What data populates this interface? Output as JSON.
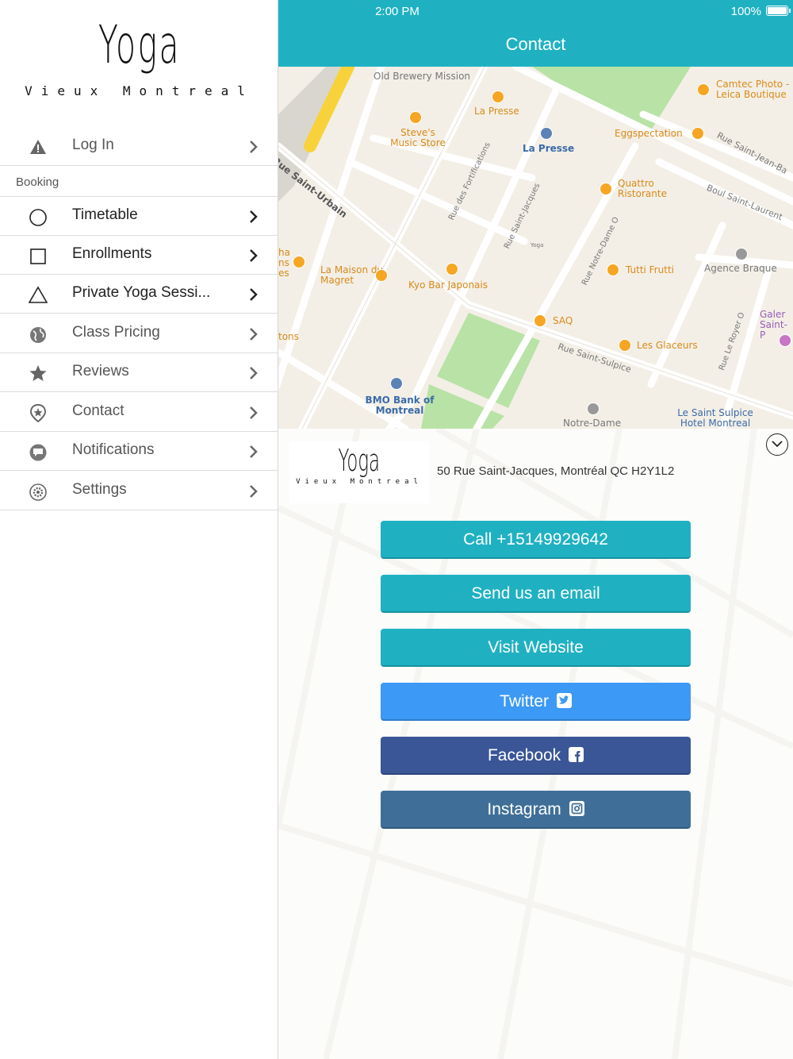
{
  "status": {
    "time": "2:00 PM",
    "battery": "100%"
  },
  "sidebar": {
    "logo": {
      "word": "Yoga",
      "subtitle": "Vieux Montreal"
    },
    "login": {
      "label": "Log In",
      "icon": "warning-icon"
    },
    "section": "Booking",
    "items": [
      {
        "label": "Timetable",
        "icon": "circle-icon"
      },
      {
        "label": "Enrollments",
        "icon": "square-icon"
      },
      {
        "label": "Private Yoga Sessi...",
        "icon": "triangle-icon"
      },
      {
        "label": "Class Pricing",
        "icon": "globe-icon"
      },
      {
        "label": "Reviews",
        "icon": "star-icon"
      },
      {
        "label": "Contact",
        "icon": "location-pin-icon"
      },
      {
        "label": "Notifications",
        "icon": "chat-bubble-icon"
      },
      {
        "label": "Settings",
        "icon": "gear-icon"
      }
    ]
  },
  "header": {
    "title": "Contact"
  },
  "map": {
    "streets": [
      "Rue Saint-Urbain",
      "Rue des Fortifications",
      "Rue Saint-Jacques",
      "Rue Notre-Dame O",
      "Rue Saint-Sulpice",
      "Rue Le Royer O",
      "Boul Saint-Laurent",
      "Rue Saint-Jean-Ba"
    ],
    "places": {
      "old_brewery": "Old Brewery Mission",
      "la_presse_food": "La Presse",
      "camtec": "Camtec Photo - Leica Boutique",
      "steves": "Steve's Music Store",
      "la_presse": "La Presse",
      "eggspectation": "Eggspectation",
      "quattro": "Quattro Ristorante",
      "ha_ns_es": "ha ns es",
      "la_maison": "La Maison du Magret",
      "kyo": "Kyo Bar Japonais",
      "tutti": "Tutti Frutti",
      "agence": "Agence Braque",
      "saq": "SAQ",
      "galer": "Galer Saint-P",
      "tons": "tons",
      "glaceurs": "Les Glaceurs",
      "bmo": "BMO Bank of Montreal",
      "notre_dame": "Notre-Dame",
      "saint_sulpice": "Le Saint Sulpice Hotel Montreal",
      "yoga_pin": "Yoga"
    }
  },
  "info": {
    "logo": {
      "word": "Yoga",
      "subtitle": "Vieux Montreal"
    },
    "address": "50 Rue Saint-Jacques, Montréal QC H2Y1L2"
  },
  "buttons": {
    "call": "Call +15149929642",
    "email": "Send us an email",
    "website": "Visit Website",
    "twitter": "Twitter",
    "facebook": "Facebook",
    "instagram": "Instagram"
  },
  "colors": {
    "teal": "#1fb1c2",
    "twitter": "#3c99f5",
    "facebook": "#3a5697",
    "instagram": "#3f6f98"
  }
}
